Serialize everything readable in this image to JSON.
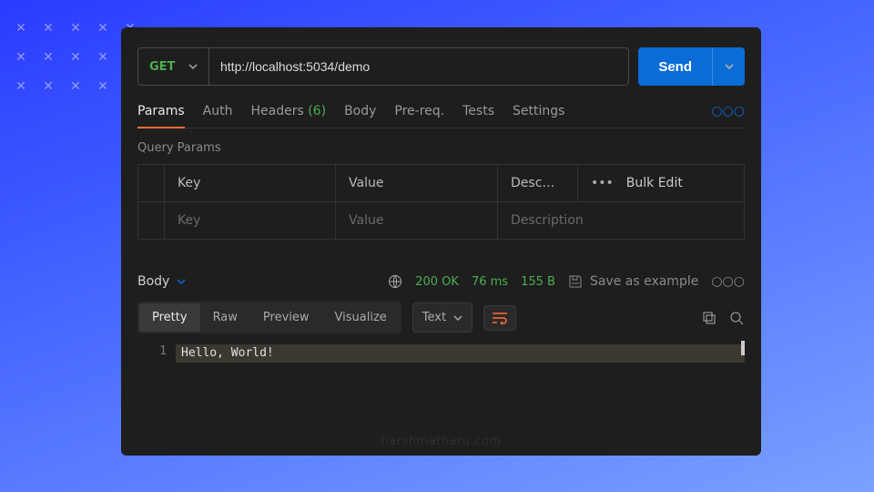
{
  "request": {
    "method": "GET",
    "url": "http://localhost:5034/demo",
    "send_label": "Send"
  },
  "tabs": {
    "items": [
      {
        "label": "Params"
      },
      {
        "label": "Auth"
      },
      {
        "label": "Headers",
        "badge": "(6)"
      },
      {
        "label": "Body"
      },
      {
        "label": "Pre-req."
      },
      {
        "label": "Tests"
      },
      {
        "label": "Settings"
      }
    ]
  },
  "params": {
    "section_title": "Query Params",
    "columns": {
      "key": "Key",
      "value": "Value",
      "desc": "Desc…"
    },
    "bulk_edit": "Bulk Edit",
    "placeholders": {
      "key": "Key",
      "value": "Value",
      "desc": "Description"
    }
  },
  "response": {
    "label": "Body",
    "status": "200 OK",
    "time": "76 ms",
    "size": "155 B",
    "save_example": "Save as example",
    "view_tabs": [
      "Pretty",
      "Raw",
      "Preview",
      "Visualize"
    ],
    "format": "Text",
    "line_no": "1",
    "content": "Hello, World!"
  },
  "watermark": "harshmatharu.com"
}
